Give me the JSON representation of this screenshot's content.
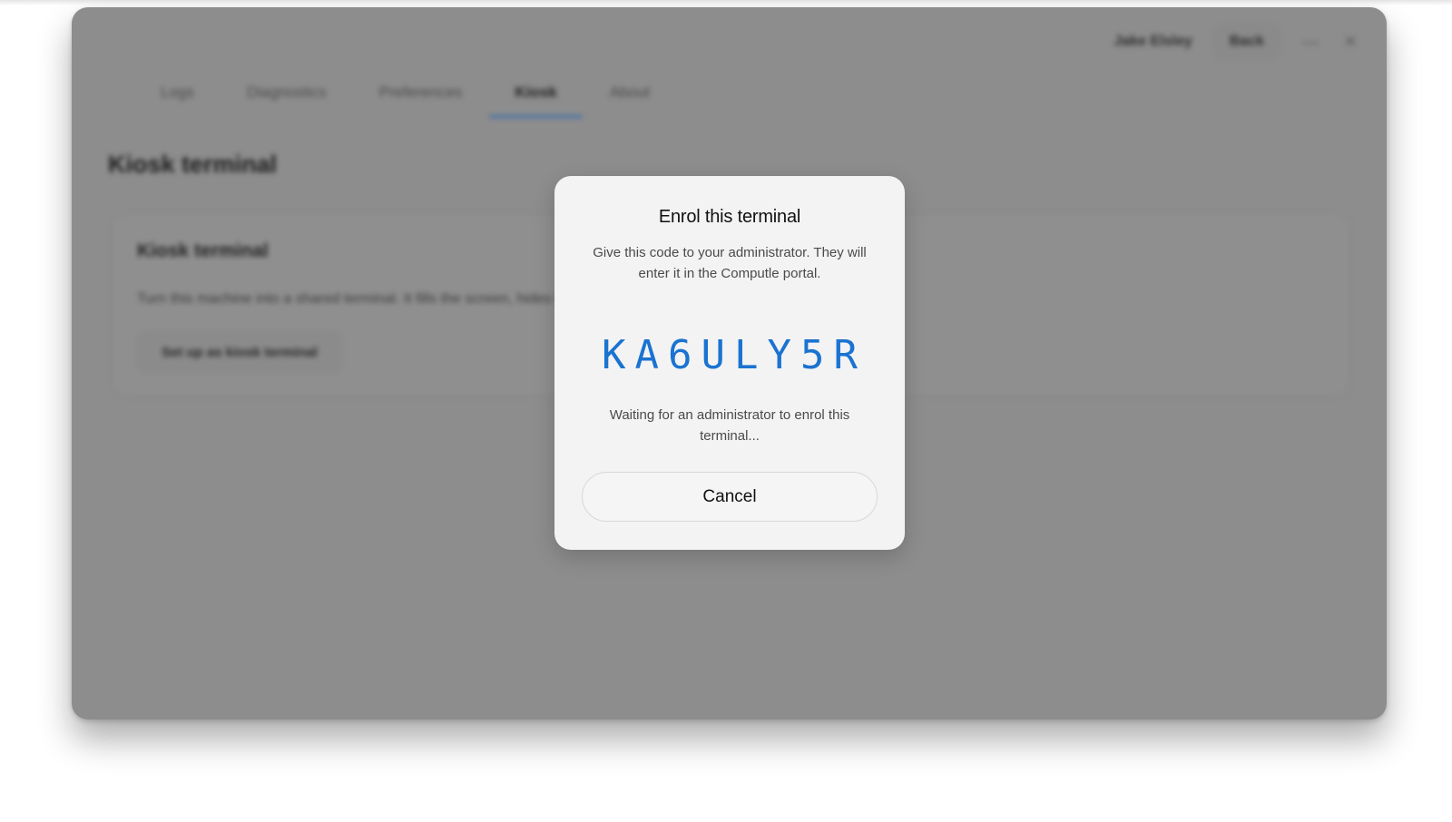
{
  "background_app": {
    "user_name": "Jake Elsley",
    "back_label": "Back",
    "minimize_icon": "minimize-icon",
    "close_icon": "close-icon",
    "tabs": [
      {
        "label": "Logs"
      },
      {
        "label": "Diagnostics"
      },
      {
        "label": "Preferences"
      },
      {
        "label": "Kiosk",
        "active": true
      },
      {
        "label": "About"
      }
    ],
    "page_title": "Kiosk terminal",
    "card": {
      "title": "Kiosk terminal",
      "description": "Turn this machine into a shared terminal. It fills the screen, hides the desktop and only runs approved apps.",
      "button_label": "Set up as kiosk terminal"
    }
  },
  "dialog": {
    "title": "Enrol this terminal",
    "description": "Give this code to your administrator. They will enter it in the Computle portal.",
    "code": "KA6ULY5R",
    "waiting_text": "Waiting for an administrator to enrol this terminal...",
    "cancel_label": "Cancel"
  },
  "colors": {
    "accent": "#1a73d0",
    "overlay": "#8d8d8d",
    "dialog_bg": "#f3f3f3"
  }
}
